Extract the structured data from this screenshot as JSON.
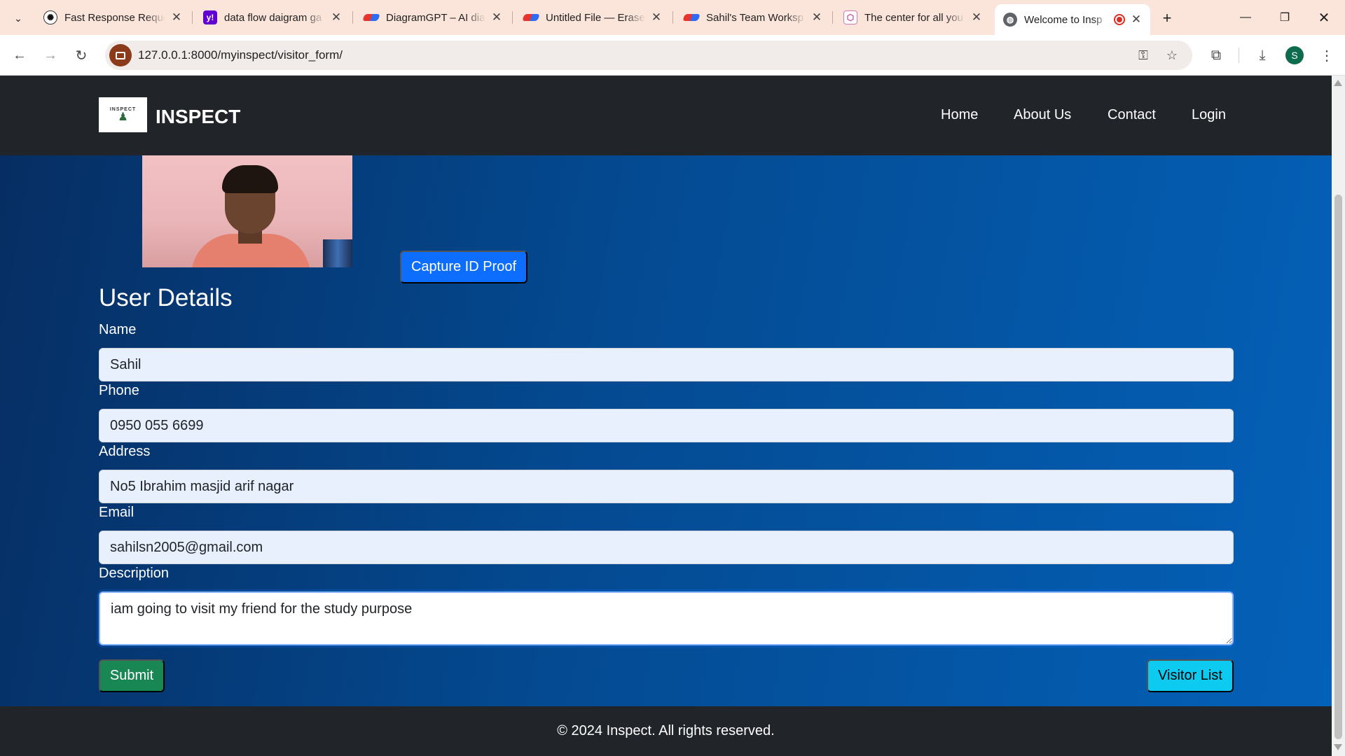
{
  "browser": {
    "tabs": [
      {
        "title": "Fast Response Reque",
        "icon": "openai-icon"
      },
      {
        "title": "data flow daigram ga",
        "icon": "yahoo-icon"
      },
      {
        "title": "DiagramGPT – AI dia",
        "icon": "eraser-icon"
      },
      {
        "title": "Untitled File — Erase",
        "icon": "eraser-icon"
      },
      {
        "title": "Sahil's Team Worksp",
        "icon": "eraser-icon"
      },
      {
        "title": "The center for all you",
        "icon": "cube-icon"
      },
      {
        "title": "Welcome to Insp",
        "icon": "globe-icon",
        "active": true,
        "recording": true
      }
    ],
    "new_tab_label": "+",
    "address": "127.0.0.1:8000/myinspect/visitor_form/",
    "profile_initial": "S"
  },
  "navbar": {
    "brand": "INSPECT",
    "logo_text": "INSPECT",
    "links": [
      "Home",
      "About Us",
      "Contact",
      "Login"
    ]
  },
  "capture_button": "Capture ID Proof",
  "form": {
    "title": "User Details",
    "fields": [
      {
        "label": "Name",
        "value": "Sahil"
      },
      {
        "label": "Phone",
        "value": "0950 055 6699"
      },
      {
        "label": "Address",
        "value": "No5 Ibrahim masjid arif nagar"
      },
      {
        "label": "Email",
        "value": "sahilsn2005@gmail.com"
      }
    ],
    "description": {
      "label": "Description",
      "value": "iam going to visit my friend for the study purpose"
    },
    "submit_label": "Submit",
    "visitor_list_label": "Visitor List"
  },
  "footer": {
    "text": "© 2024 Inspect. All rights reserved."
  },
  "colors": {
    "navbar": "#212529",
    "primary": "#0d6efd",
    "success": "#198754",
    "info": "#0dcaf0",
    "tabstrip": "#fbe4d9"
  }
}
